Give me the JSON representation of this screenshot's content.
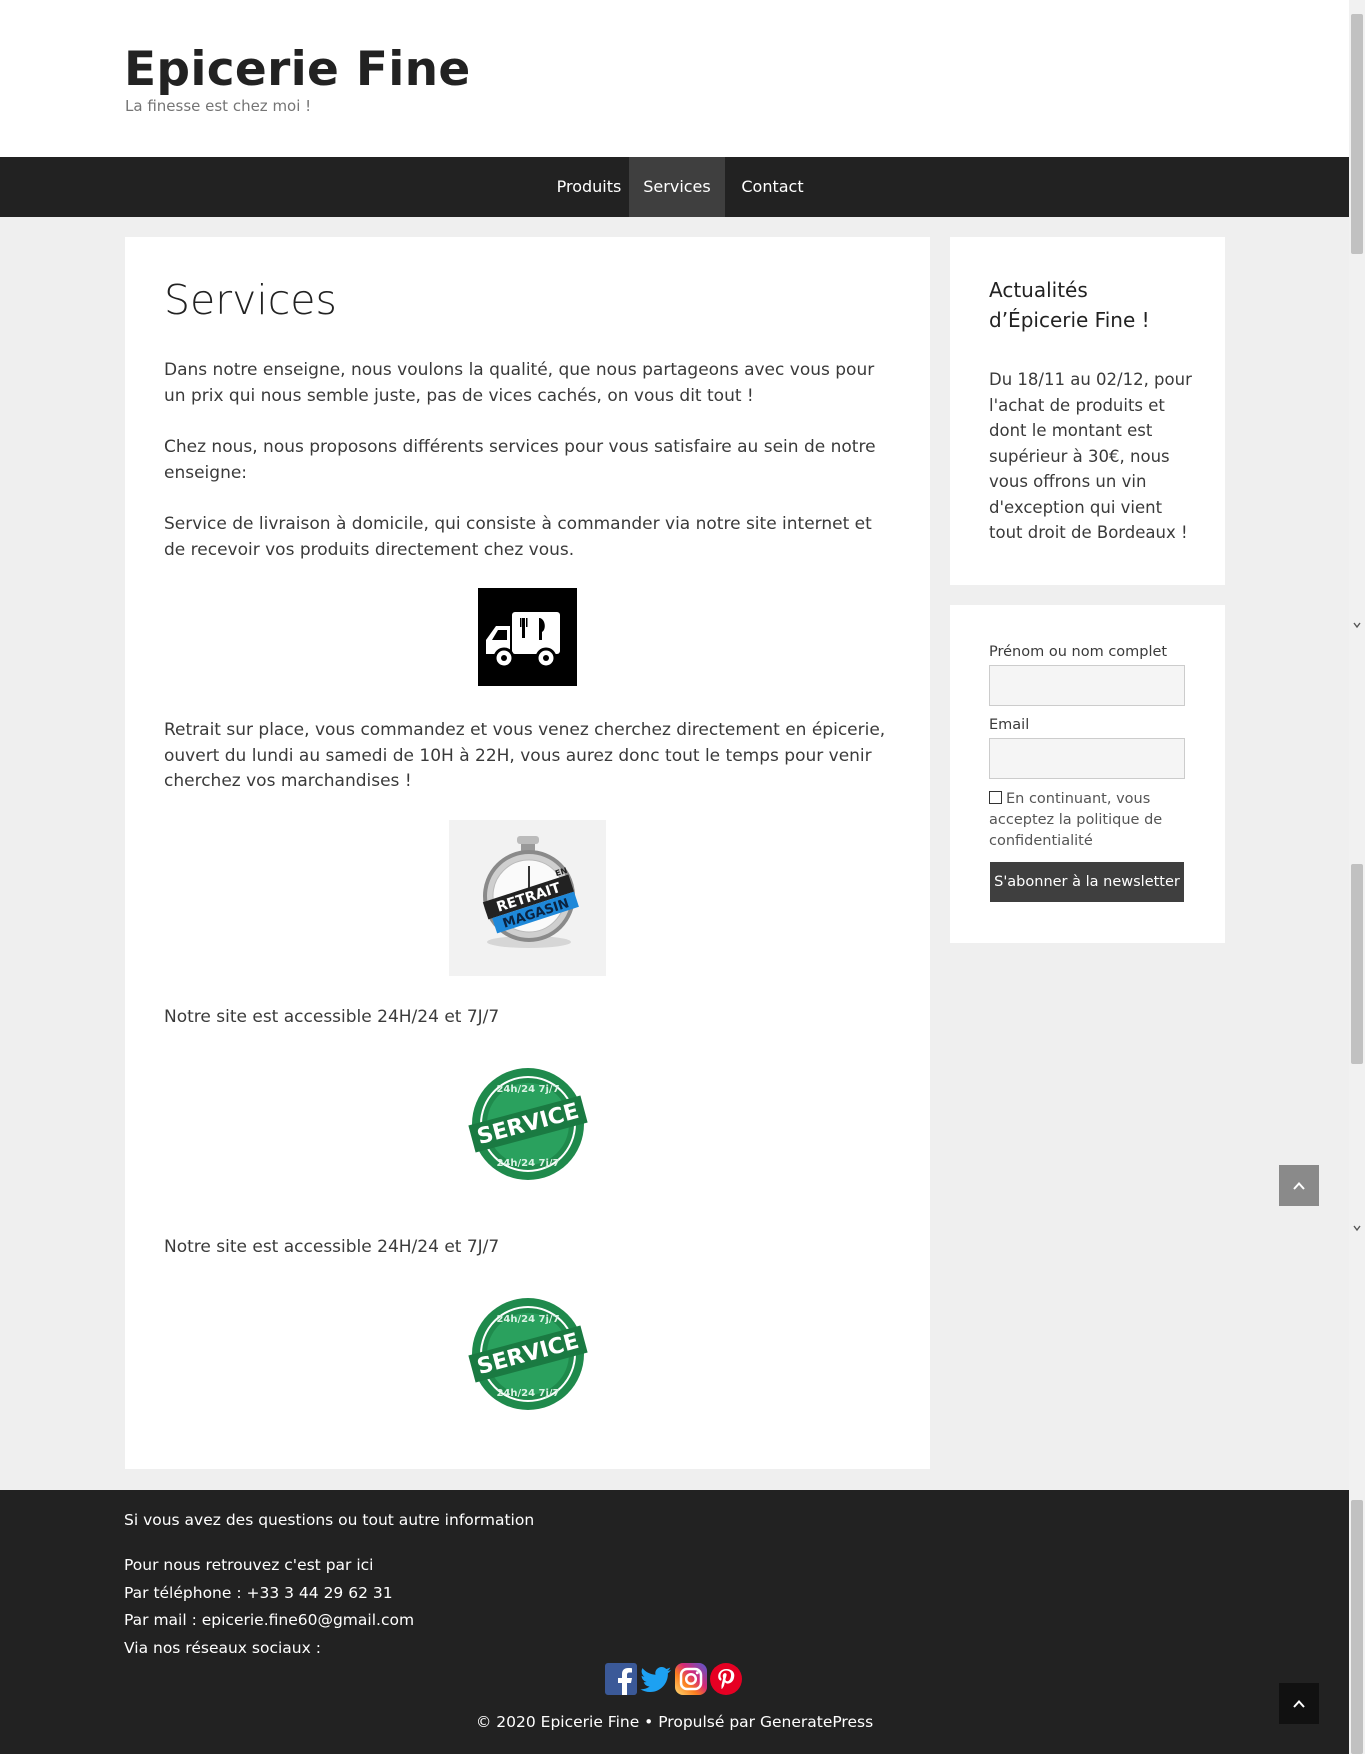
{
  "header": {
    "site_title": "Epicerie Fine",
    "tagline": "La finesse est chez moi !"
  },
  "nav": {
    "items": [
      {
        "label": "Produits"
      },
      {
        "label": "Services",
        "active": true
      },
      {
        "label": "Contact"
      }
    ]
  },
  "main": {
    "title": "Services",
    "paragraphs": [
      "Dans notre enseigne, nous voulons la qualité, que nous partageons avec vous pour un prix qui nous semble juste, pas de vices cachés, on vous dit tout !",
      "Chez nous, nous proposons différents services pour vous satisfaire au sein de notre enseigne:",
      "Service de livraison à domicile, qui consiste à commander via notre site internet et de recevoir vos produits directement chez vous.",
      "Retrait sur place, vous commandez et vous venez cherchez directement en épicerie, ouvert du lundi au samedi de 10H à 22H, vous aurez donc tout le temps pour venir cherchez vos marchandises !",
      "Notre site est accessible 24H/24 et 7J/7",
      "Notre site est accessible 24H/24 et 7J/7"
    ],
    "images": {
      "retrait_top": "RETRAIT",
      "retrait_tag": "EN",
      "retrait_bottom": "MAGASIN",
      "service_ring": "24h/24 7j/7",
      "service_word": "SERVICE"
    }
  },
  "sidebar": {
    "news_title": "Actualités d’Épicerie Fine !",
    "news_text": "Du 18/11 au 02/12, pour l'achat de produits et dont le montant est supérieur à 30€, nous vous offrons un vin d'exception qui vient tout droit de Bordeaux !",
    "form": {
      "name_label": "Prénom ou nom complet",
      "name_value": "",
      "email_label": "Email",
      "email_value": "",
      "consent": "En continuant, vous acceptez la politique de confidentialité",
      "submit_label": "S'abonner à la newsletter"
    }
  },
  "footer": {
    "intro": "Si vous avez des questions ou tout autre information",
    "find_us": "Pour nous retrouvez c'est par ici",
    "phone": "Par téléphone : +33 3 44 29 62 31",
    "mail": "Par mail : epicerie.fine60@gmail.com",
    "social_intro": "Via nos réseaux sociaux :",
    "social": [
      "facebook-icon",
      "twitter-icon",
      "instagram-icon",
      "pinterest-icon"
    ],
    "copyright": "© 2020 Epicerie Fine • Propulsé par GeneratePress"
  },
  "colors": {
    "nav_bg": "#222222",
    "nav_active": "#3f3f3f",
    "service_green": "#1f8a4c",
    "retrait_blue": "#1e88d9",
    "facebook": "#3b5998",
    "twitter": "#1da1f2",
    "pinterest": "#e60023"
  }
}
